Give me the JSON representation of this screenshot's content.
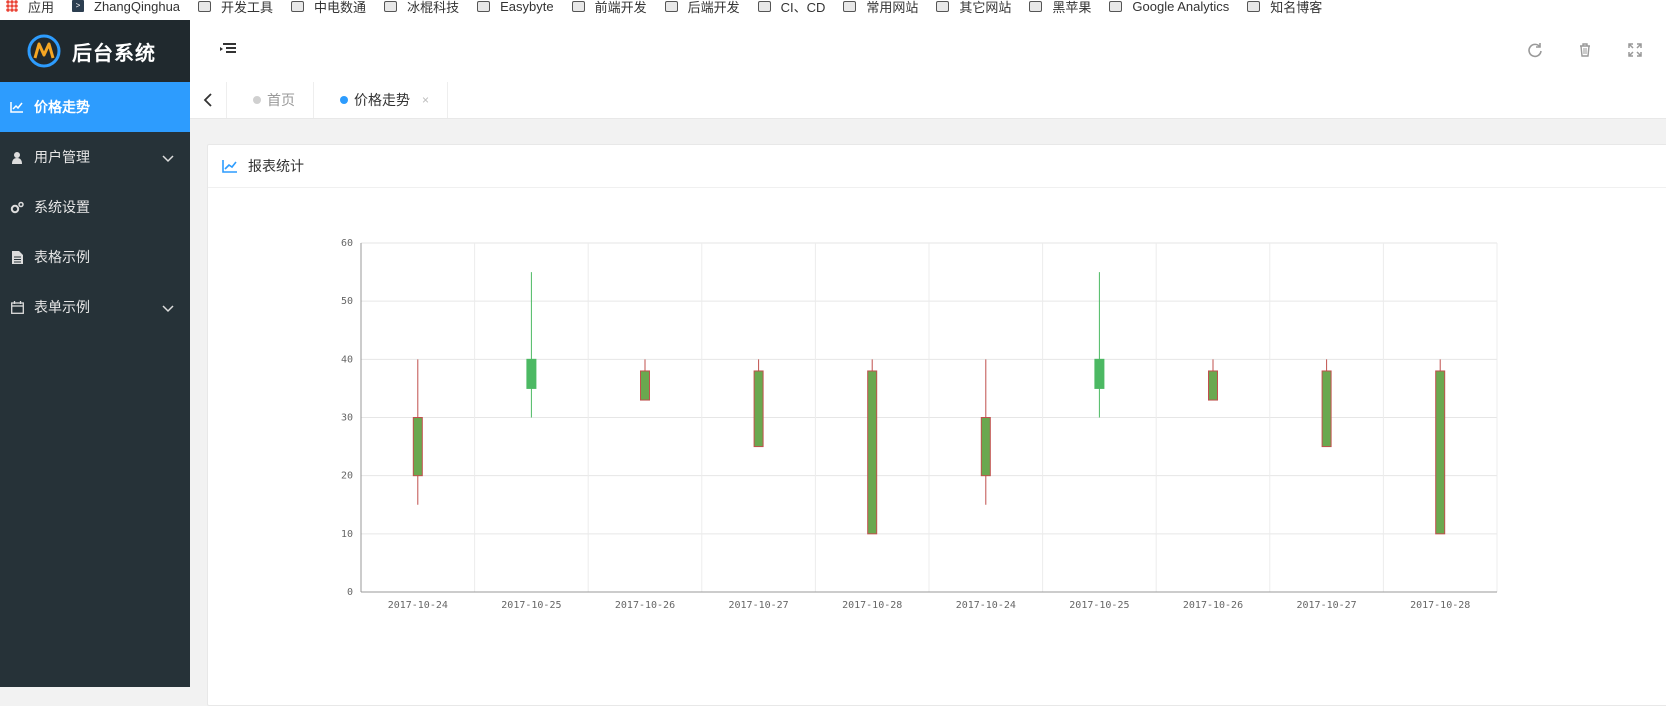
{
  "bookmarks": {
    "items": [
      {
        "label": "应用",
        "icon": "apps-grid-icon"
      },
      {
        "label": "ZhangQinghua",
        "icon": "terminal-icon"
      },
      {
        "label": "开发工具",
        "icon": "folder-icon"
      },
      {
        "label": "中电数通",
        "icon": "folder-icon"
      },
      {
        "label": "冰棍科技",
        "icon": "folder-icon"
      },
      {
        "label": "Easybyte",
        "icon": "folder-icon"
      },
      {
        "label": "前端开发",
        "icon": "folder-icon"
      },
      {
        "label": "后端开发",
        "icon": "folder-icon"
      },
      {
        "label": "CI、CD",
        "icon": "folder-icon"
      },
      {
        "label": "常用网站",
        "icon": "folder-icon"
      },
      {
        "label": "其它网站",
        "icon": "folder-icon"
      },
      {
        "label": "黑苹果",
        "icon": "folder-icon"
      },
      {
        "label": "Google Analytics",
        "icon": "folder-icon"
      },
      {
        "label": "知名博客",
        "icon": "folder-icon"
      }
    ]
  },
  "app": {
    "title": "后台系统"
  },
  "sidebar": {
    "items": [
      {
        "label": "价格走势",
        "icon": "line-chart-icon",
        "active": true
      },
      {
        "label": "用户管理",
        "icon": "user-icon",
        "has_children": true
      },
      {
        "label": "系统设置",
        "icon": "gears-icon"
      },
      {
        "label": "表格示例",
        "icon": "document-icon"
      },
      {
        "label": "表单示例",
        "icon": "calendar-icon",
        "has_children": true
      }
    ]
  },
  "header": {
    "toggle_icon": "menu-fold-icon",
    "actions": [
      {
        "icon": "refresh-icon"
      },
      {
        "icon": "trash-icon"
      },
      {
        "icon": "fullscreen-icon"
      }
    ]
  },
  "tabs": [
    {
      "label": "首页",
      "active": false
    },
    {
      "label": "价格走势",
      "active": true,
      "closable": true,
      "close_label": "×"
    }
  ],
  "card": {
    "title": "报表统计",
    "icon": "line-chart-icon"
  },
  "colors": {
    "accent": "#2d9cfe",
    "sidebar_bg": "#263238",
    "candle_up": "#4cb963",
    "candle_down_body": "#6aa84f",
    "candle_down_border": "#c0504d",
    "wick_up": "#4cb963",
    "wick_down": "#c0504d"
  },
  "chart_data": {
    "type": "candlestick",
    "title": "",
    "xlabel": "",
    "ylabel": "",
    "ylim": [
      0,
      60
    ],
    "yticks": [
      0,
      10,
      20,
      30,
      40,
      50,
      60
    ],
    "grid": true,
    "categories": [
      "2017-10-24",
      "2017-10-25",
      "2017-10-26",
      "2017-10-27",
      "2017-10-28",
      "2017-10-24",
      "2017-10-25",
      "2017-10-26",
      "2017-10-27",
      "2017-10-28"
    ],
    "series": [
      {
        "values": [
          {
            "open": 20,
            "close": 30,
            "low": 15,
            "high": 40
          },
          {
            "open": 40,
            "close": 35,
            "low": 30,
            "high": 55
          },
          {
            "open": 33,
            "close": 38,
            "low": 33,
            "high": 40
          },
          {
            "open": 38,
            "close": 25,
            "low": 25,
            "high": 40
          },
          {
            "open": 38,
            "close": 10,
            "low": 10,
            "high": 40
          },
          {
            "open": 20,
            "close": 30,
            "low": 15,
            "high": 40
          },
          {
            "open": 40,
            "close": 35,
            "low": 30,
            "high": 55
          },
          {
            "open": 33,
            "close": 38,
            "low": 33,
            "high": 40
          },
          {
            "open": 38,
            "close": 25,
            "low": 25,
            "high": 40
          },
          {
            "open": 38,
            "close": 10,
            "low": 10,
            "high": 40
          }
        ]
      }
    ]
  }
}
